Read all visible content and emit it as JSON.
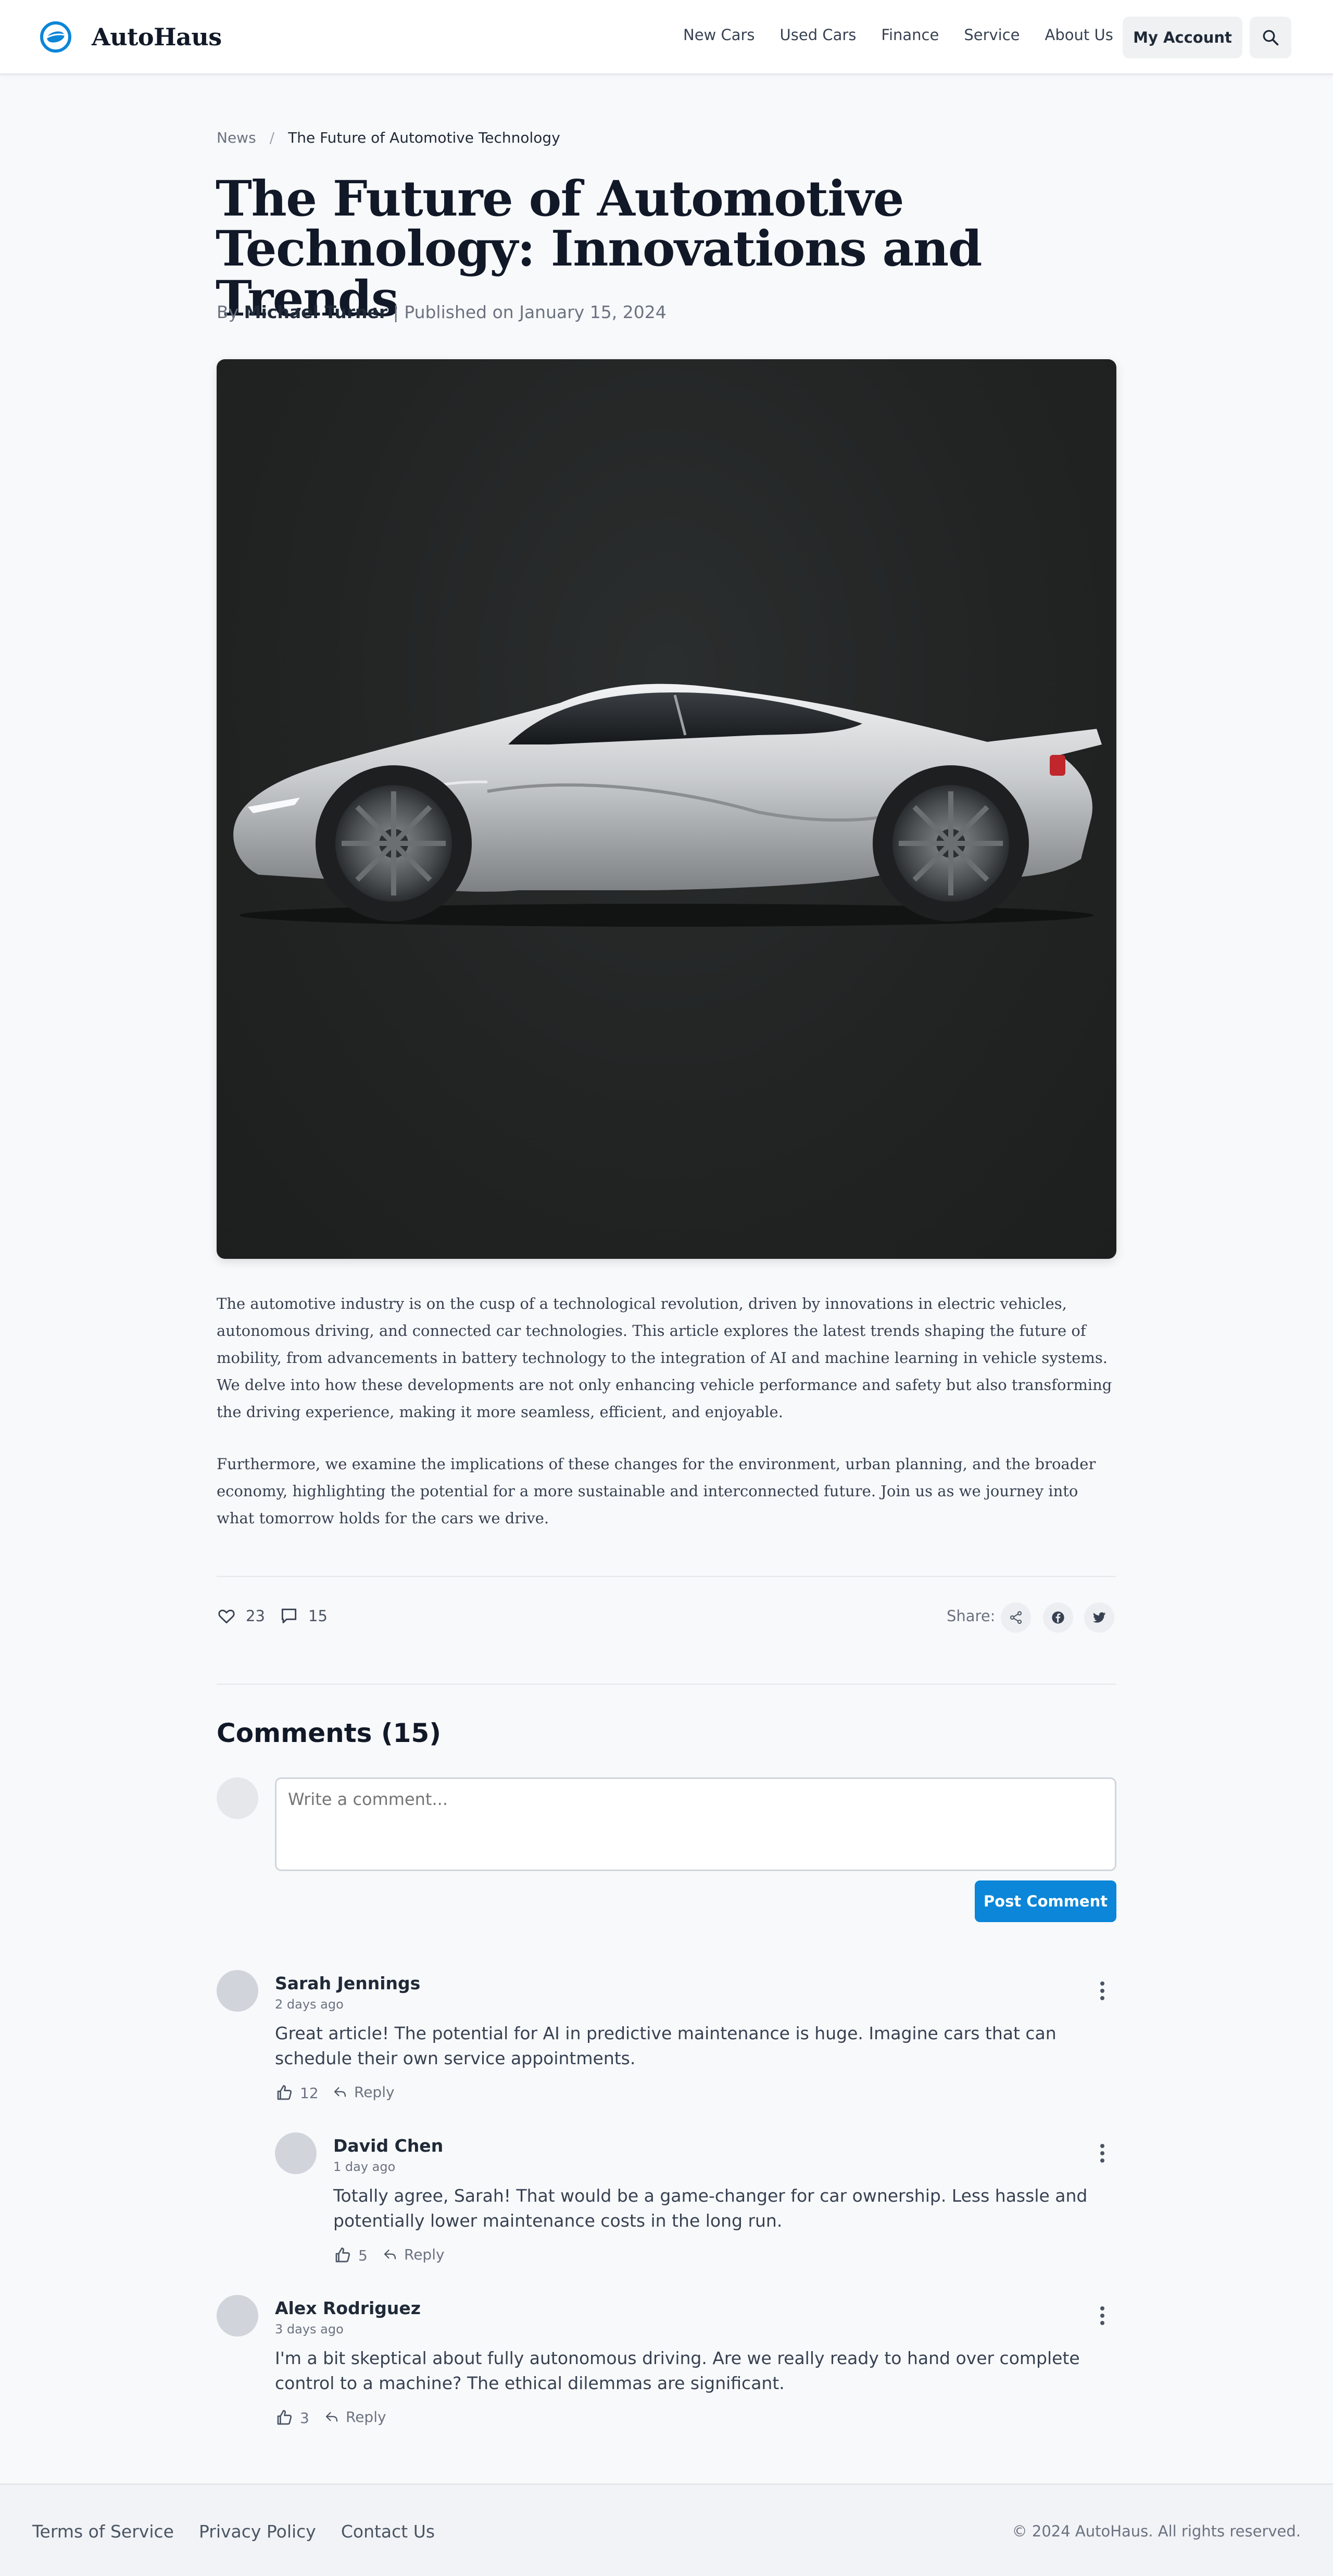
{
  "header": {
    "brand": "AutoHaus",
    "nav": [
      "New Cars",
      "Used Cars",
      "Finance",
      "Service",
      "About Us"
    ],
    "account_label": "My Account",
    "accent_color": "#0b86d8"
  },
  "breadcrumb": {
    "section": "News",
    "separator": "/",
    "current": "The Future of Automotive Technology"
  },
  "article": {
    "title": "The Future of Automotive Technology: Innovations and Trends",
    "by_prefix": "By",
    "author": "Michael Turner",
    "published": "| Published on January 15, 2024",
    "hero_image": "silver sports car on dark background",
    "paragraphs": [
      "The automotive industry is on the cusp of a technological revolution, driven by innovations in electric vehicles, autonomous driving, and connected car technologies. This article explores the latest trends shaping the future of mobility, from advancements in battery technology to the integration of AI and machine learning in vehicle systems. We delve into how these developments are not only enhancing vehicle performance and safety but also transforming the driving experience, making it more seamless, efficient, and enjoyable.",
      "Furthermore, we examine the implications of these changes for the environment, urban planning, and the broader economy, highlighting the potential for a more sustainable and interconnected future. Join us as we journey into what tomorrow holds for the cars we drive."
    ],
    "likes": "23",
    "comment_count": "15",
    "share_label": "Share:"
  },
  "comments": {
    "heading": "Comments (15)",
    "placeholder": "Write a comment...",
    "post_label": "Post Comment",
    "reply_label": "Reply",
    "items": [
      {
        "name": "Sarah Jennings",
        "time": "2 days ago",
        "text": "Great article! The potential for AI in predictive maintenance is huge. Imagine cars that can schedule their own service appointments.",
        "likes": "12"
      },
      {
        "name": "David Chen",
        "time": "1 day ago",
        "text": "Totally agree, Sarah! That would be a game-changer for car ownership. Less hassle and potentially lower maintenance costs in the long run.",
        "likes": "5"
      },
      {
        "name": "Alex Rodriguez",
        "time": "3 days ago",
        "text": "I'm a bit skeptical about fully autonomous driving. Are we really ready to hand over complete control to a machine? The ethical dilemmas are significant.",
        "likes": "3"
      }
    ]
  },
  "footer": {
    "links": [
      "Terms of Service",
      "Privacy Policy",
      "Contact Us"
    ],
    "copyright": "© 2024 AutoHaus. All rights reserved."
  }
}
